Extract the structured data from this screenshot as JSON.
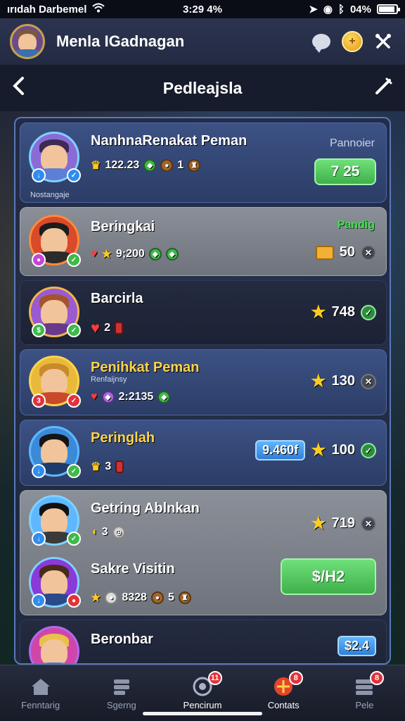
{
  "status_bar": {
    "carrier": "ırıdah Darbemel",
    "time": "3:29 4%",
    "battery": "04%",
    "battery_level": 0.9
  },
  "header": {
    "title": "Menla IGadnagan",
    "icons": [
      "chat-icon",
      "coin-icon",
      "tools-icon"
    ]
  },
  "nav": {
    "title": "Pedleajsla",
    "back_icon": "chevron-left-icon",
    "edit_icon": "edit-icon"
  },
  "rows": [
    {
      "name": "NanhnaRenakat Peman",
      "sub": "Nostangaje",
      "stats": [
        "122.23",
        "1"
      ],
      "right_label": "Pannoier",
      "button": "7 25"
    },
    {
      "name": "Beringkai",
      "stats": [
        "9;200"
      ],
      "right_label": "Pandig",
      "right_value": "50"
    },
    {
      "name": "Barcirla",
      "stats": [
        "2"
      ],
      "right_value": "748"
    },
    {
      "name": "Penihkat Peman",
      "sub": "Renfaijnsy",
      "stats": [
        "2:2135"
      ],
      "right_value": "130"
    },
    {
      "name": "Peringlah",
      "stats": [
        "3"
      ],
      "tag": "9.460f",
      "right_value": "100"
    },
    {
      "name": "Getring Ablnkan",
      "stats": [
        "3"
      ],
      "right_value": "719"
    },
    {
      "name": "Sakre Visitin",
      "stats": [
        "8328",
        "5"
      ],
      "button": "$/H2"
    },
    {
      "name": "Beronbar",
      "tag": "$2.4"
    }
  ],
  "tabs": [
    {
      "label": "Fenntarig",
      "icon": "home-icon"
    },
    {
      "label": "Sgerng",
      "icon": "cards-icon"
    },
    {
      "label": "Pencirum",
      "icon": "target-icon",
      "badge": "11"
    },
    {
      "label": "Contats",
      "icon": "gift-icon",
      "badge": "8"
    },
    {
      "label": "Pele",
      "icon": "stack-icon",
      "badge": "8"
    }
  ]
}
